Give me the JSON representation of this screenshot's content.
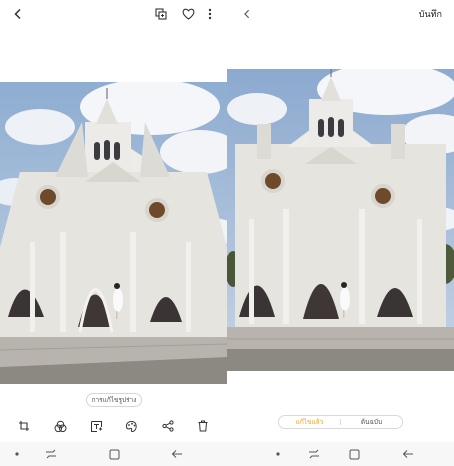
{
  "left": {
    "edit_chip_label": "การแก้ไขรูปร่าง",
    "toolbar_icons": [
      "crop-rotate-icon",
      "filter-icon",
      "text-sticker-icon",
      "paint-icon",
      "share-icon",
      "trash-icon"
    ]
  },
  "right": {
    "save_label": "บันทึก",
    "compare": {
      "options": [
        "แก้ไขแล้ว",
        "ต้นฉบับ"
      ],
      "selected": "แก้ไขแล้ว"
    }
  },
  "colors": {
    "accent": "#f0a033",
    "sky": "#9bb6d6",
    "cloud": "#f3f5f8",
    "facade": "#e8e6e2",
    "nav_bg": "#f7f7f7"
  }
}
